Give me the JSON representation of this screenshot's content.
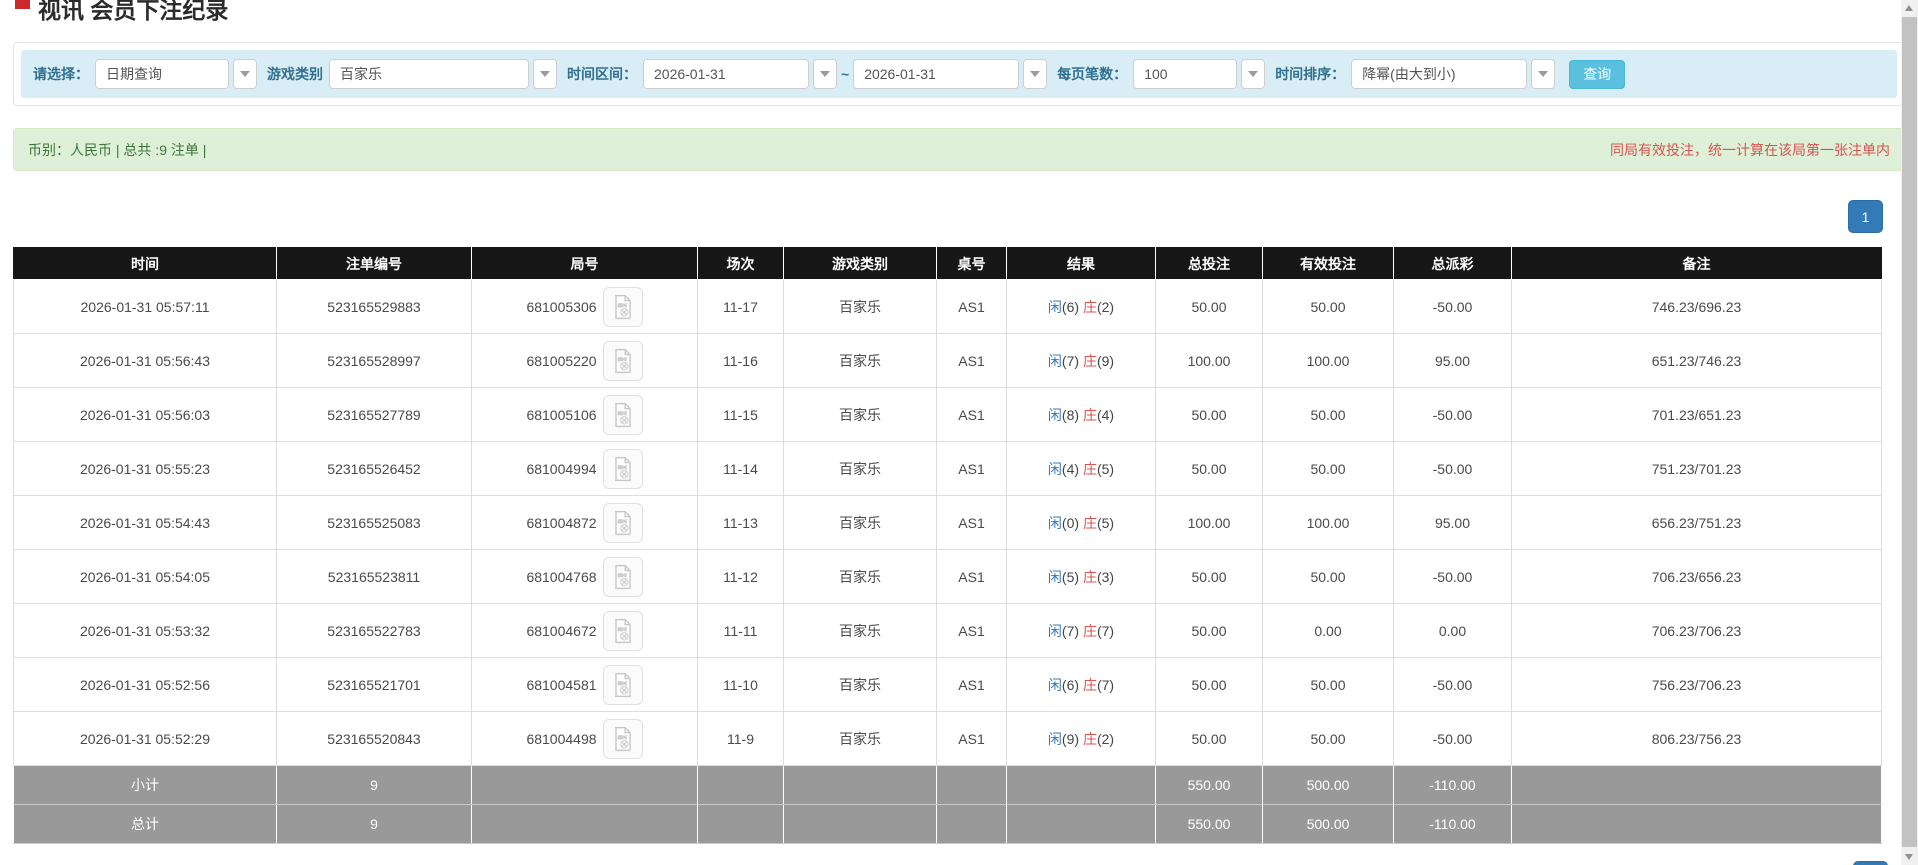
{
  "page": {
    "title": "视讯 会员下注纪录"
  },
  "colors": {
    "accent_blue": "#337ab7",
    "filter_bg": "#d9edf7",
    "success_bg": "#dff0d8",
    "success_text": "#3c763d",
    "warning_text": "#d9534f",
    "negative_red": "#ff0000",
    "header_bg": "#171717",
    "footer_bg": "#999999",
    "query_button": "#5bc0de"
  },
  "filters": {
    "select_label": "请选择：",
    "select_value": "日期查询",
    "game_label": "游戏类别",
    "game_value": "百家乐",
    "range_label": "时间区间：",
    "date_from": "2026-01-31",
    "tilde": "~",
    "date_to": "2026-01-31",
    "per_page_label": "每页笔数：",
    "per_page_value": "100",
    "sort_label": "时间排序：",
    "sort_value": "降幂(由大到小)",
    "query_button": "查询"
  },
  "summary": {
    "left": "币别：人民币 | 总共 :9 注单 |",
    "right": "同局有效投注，统一计算在该局第一张注单内"
  },
  "pagination": {
    "page": "1"
  },
  "table": {
    "headers": [
      "时间",
      "注单编号",
      "局号",
      "场次",
      "游戏类别",
      "桌号",
      "结果",
      "总投注",
      "有效投注",
      "总派彩",
      "备注"
    ],
    "rows": [
      {
        "time": "2026-01-31 05:57:11",
        "bet_id": "523165529883",
        "round": "681005306",
        "session": "11-17",
        "game": "百家乐",
        "table_no": "AS1",
        "player": "闲",
        "player_n": "(6)",
        "banker": "庄",
        "banker_n": "(2)",
        "total_bet": "50.00",
        "valid_bet": "50.00",
        "payout": "-50.00",
        "note": "746.23/696.23"
      },
      {
        "time": "2026-01-31 05:56:43",
        "bet_id": "523165528997",
        "round": "681005220",
        "session": "11-16",
        "game": "百家乐",
        "table_no": "AS1",
        "player": "闲",
        "player_n": "(7)",
        "banker": "庄",
        "banker_n": "(9)",
        "total_bet": "100.00",
        "valid_bet": "100.00",
        "payout": "95.00",
        "note": "651.23/746.23"
      },
      {
        "time": "2026-01-31 05:56:03",
        "bet_id": "523165527789",
        "round": "681005106",
        "session": "11-15",
        "game": "百家乐",
        "table_no": "AS1",
        "player": "闲",
        "player_n": "(8)",
        "banker": "庄",
        "banker_n": "(4)",
        "total_bet": "50.00",
        "valid_bet": "50.00",
        "payout": "-50.00",
        "note": "701.23/651.23"
      },
      {
        "time": "2026-01-31 05:55:23",
        "bet_id": "523165526452",
        "round": "681004994",
        "session": "11-14",
        "game": "百家乐",
        "table_no": "AS1",
        "player": "闲",
        "player_n": "(4)",
        "banker": "庄",
        "banker_n": "(5)",
        "total_bet": "50.00",
        "valid_bet": "50.00",
        "payout": "-50.00",
        "note": "751.23/701.23"
      },
      {
        "time": "2026-01-31 05:54:43",
        "bet_id": "523165525083",
        "round": "681004872",
        "session": "11-13",
        "game": "百家乐",
        "table_no": "AS1",
        "player": "闲",
        "player_n": "(0)",
        "banker": "庄",
        "banker_n": "(5)",
        "total_bet": "100.00",
        "valid_bet": "100.00",
        "payout": "95.00",
        "note": "656.23/751.23"
      },
      {
        "time": "2026-01-31 05:54:05",
        "bet_id": "523165523811",
        "round": "681004768",
        "session": "11-12",
        "game": "百家乐",
        "table_no": "AS1",
        "player": "闲",
        "player_n": "(5)",
        "banker": "庄",
        "banker_n": "(3)",
        "total_bet": "50.00",
        "valid_bet": "50.00",
        "payout": "-50.00",
        "note": "706.23/656.23"
      },
      {
        "time": "2026-01-31 05:53:32",
        "bet_id": "523165522783",
        "round": "681004672",
        "session": "11-11",
        "game": "百家乐",
        "table_no": "AS1",
        "player": "闲",
        "player_n": "(7)",
        "banker": "庄",
        "banker_n": "(7)",
        "total_bet": "50.00",
        "valid_bet": "0.00",
        "payout": "0.00",
        "note": "706.23/706.23"
      },
      {
        "time": "2026-01-31 05:52:56",
        "bet_id": "523165521701",
        "round": "681004581",
        "session": "11-10",
        "game": "百家乐",
        "table_no": "AS1",
        "player": "闲",
        "player_n": "(6)",
        "banker": "庄",
        "banker_n": "(7)",
        "total_bet": "50.00",
        "valid_bet": "50.00",
        "payout": "-50.00",
        "note": "756.23/706.23"
      },
      {
        "time": "2026-01-31 05:52:29",
        "bet_id": "523165520843",
        "round": "681004498",
        "session": "11-9",
        "game": "百家乐",
        "table_no": "AS1",
        "player": "闲",
        "player_n": "(9)",
        "banker": "庄",
        "banker_n": "(2)",
        "total_bet": "50.00",
        "valid_bet": "50.00",
        "payout": "-50.00",
        "note": "806.23/756.23"
      }
    ],
    "subtotal": {
      "label": "小计",
      "count": "9",
      "total_bet": "550.00",
      "valid_bet": "500.00",
      "payout": "-110.00",
      "note": ""
    },
    "total": {
      "label": "总计",
      "count": "9",
      "total_bet": "550.00",
      "valid_bet": "500.00",
      "payout": "-110.00",
      "note": ""
    }
  }
}
